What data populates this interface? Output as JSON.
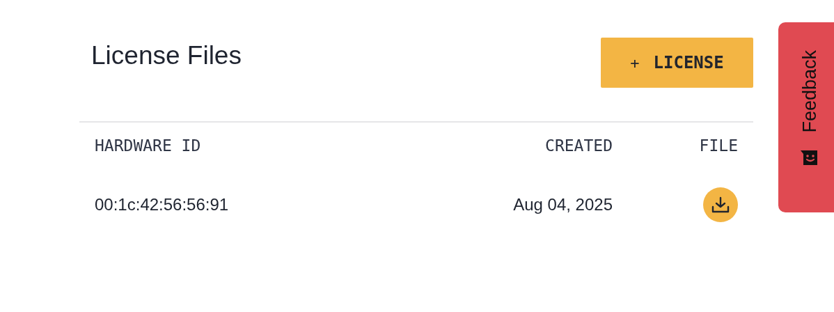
{
  "page": {
    "title": "License Files"
  },
  "add_button": {
    "icon": "+",
    "label": "LICENSE"
  },
  "table": {
    "columns": [
      "HARDWARE ID",
      "CREATED",
      "FILE"
    ],
    "rows": [
      {
        "hardware_id": "00:1c:42:56:56:91",
        "created": "Aug 04, 2025"
      }
    ]
  },
  "feedback_tab": {
    "label": "Feedback"
  }
}
